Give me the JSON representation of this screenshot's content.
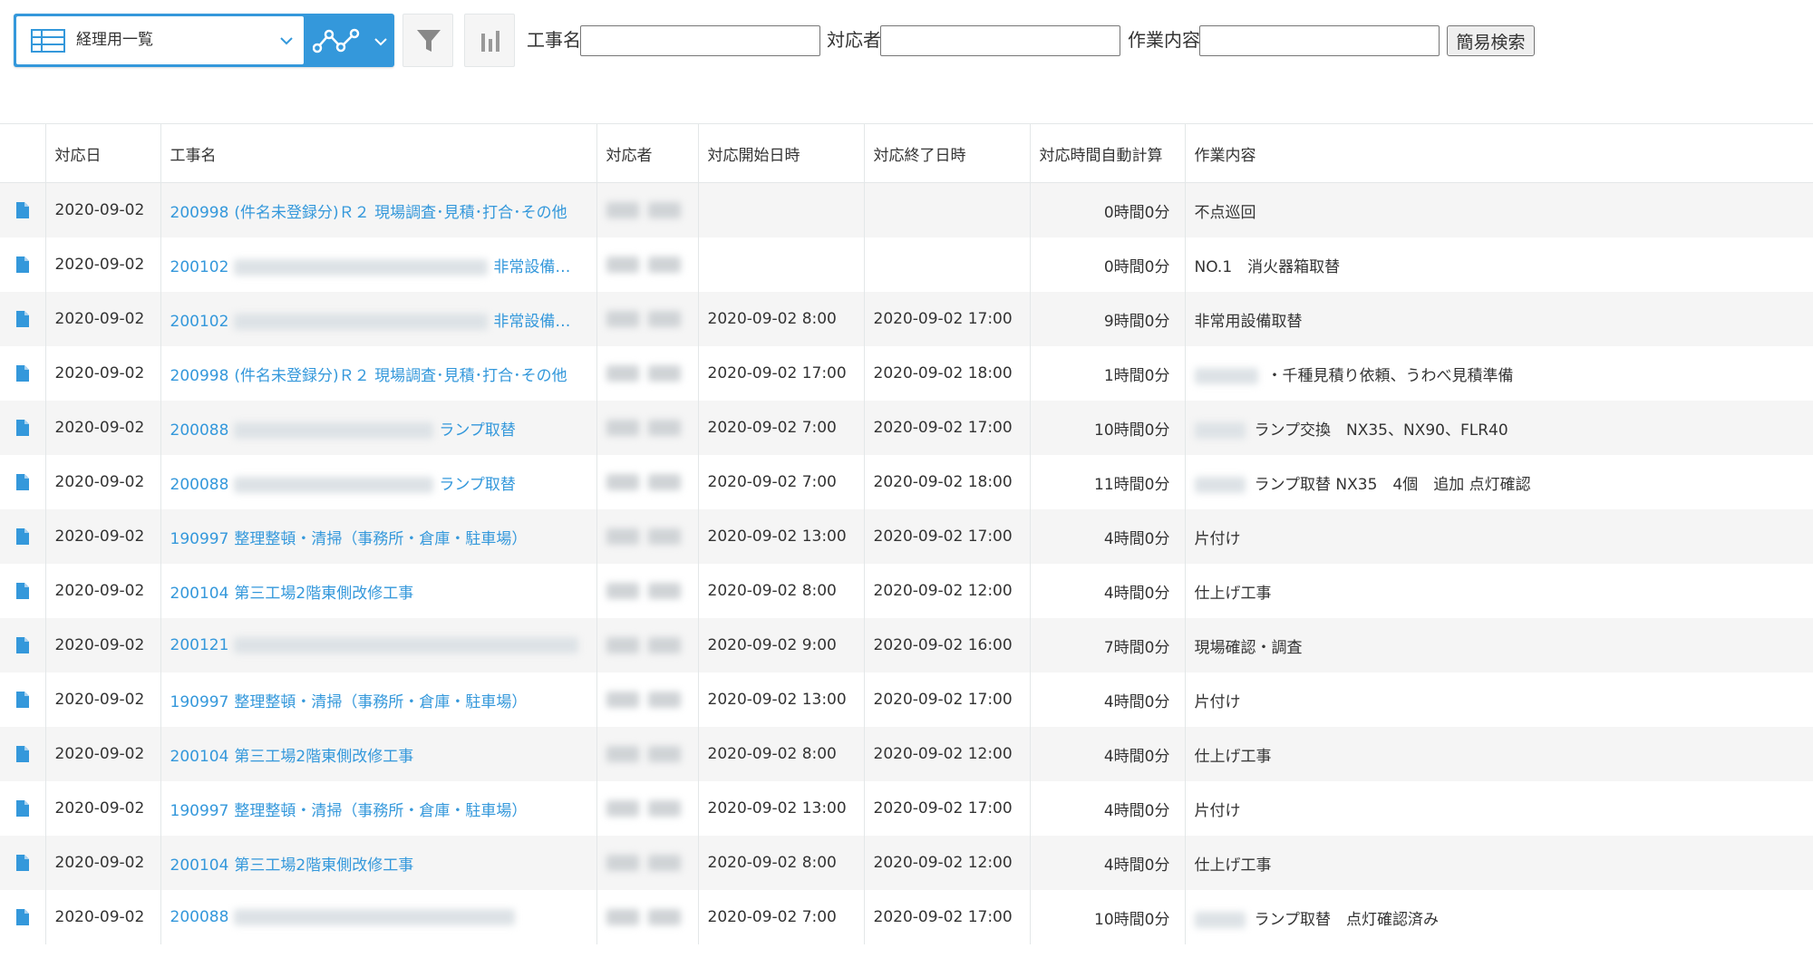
{
  "toolbar": {
    "view_name": "経理用一覧",
    "filters": [
      {
        "label": "工事名",
        "value": ""
      },
      {
        "label": "対応者",
        "value": ""
      },
      {
        "label": "作業内容",
        "value": ""
      }
    ],
    "search_button": "簡易検索"
  },
  "colors": {
    "accent": "#3498db",
    "link": "#3498db",
    "row_alt": "#f5f5f5",
    "border": "#e3e7e8"
  },
  "table": {
    "columns": [
      "対応日",
      "工事名",
      "対応者",
      "対応開始日時",
      "対応終了日時",
      "対応時間自動計算",
      "作業内容"
    ],
    "rows": [
      {
        "date": "2020-09-02",
        "project_code": "200998",
        "project_text": "(件名未登録分)Ｒ２ 現場調査･見積･打合･その他",
        "start": "",
        "end": "",
        "duration": "0時間0分",
        "work": "不点巡回"
      },
      {
        "date": "2020-09-02",
        "project_code": "200102",
        "project_text": "非常設備…",
        "start": "",
        "end": "",
        "duration": "0時間0分",
        "work": "NO.1　消火器箱取替"
      },
      {
        "date": "2020-09-02",
        "project_code": "200102",
        "project_text": "非常設備…",
        "start": "2020-09-02 8:00",
        "end": "2020-09-02 17:00",
        "duration": "9時間0分",
        "work": "非常用設備取替"
      },
      {
        "date": "2020-09-02",
        "project_code": "200998",
        "project_text": "(件名未登録分)Ｒ２ 現場調査･見積･打合･その他",
        "start": "2020-09-02 17:00",
        "end": "2020-09-02 18:00",
        "duration": "1時間0分",
        "work": "・千種見積り依頼、うわべ見積準備"
      },
      {
        "date": "2020-09-02",
        "project_code": "200088",
        "project_text": "ランプ取替",
        "start": "2020-09-02 7:00",
        "end": "2020-09-02 17:00",
        "duration": "10時間0分",
        "work": "ランプ交換　NX35、NX90、FLR40"
      },
      {
        "date": "2020-09-02",
        "project_code": "200088",
        "project_text": "ランプ取替",
        "start": "2020-09-02 7:00",
        "end": "2020-09-02 18:00",
        "duration": "11時間0分",
        "work": "ランプ取替 NX35　4個　追加 点灯確認"
      },
      {
        "date": "2020-09-02",
        "project_code": "190997",
        "project_text": "整理整頓・清掃（事務所・倉庫・駐車場）",
        "start": "2020-09-02 13:00",
        "end": "2020-09-02 17:00",
        "duration": "4時間0分",
        "work": "片付け"
      },
      {
        "date": "2020-09-02",
        "project_code": "200104",
        "project_text": "第三工場2階東側改修工事",
        "start": "2020-09-02 8:00",
        "end": "2020-09-02 12:00",
        "duration": "4時間0分",
        "work": "仕上げ工事"
      },
      {
        "date": "2020-09-02",
        "project_code": "200121",
        "project_text": "",
        "start": "2020-09-02 9:00",
        "end": "2020-09-02 16:00",
        "duration": "7時間0分",
        "work": "現場確認・調査"
      },
      {
        "date": "2020-09-02",
        "project_code": "190997",
        "project_text": "整理整頓・清掃（事務所・倉庫・駐車場）",
        "start": "2020-09-02 13:00",
        "end": "2020-09-02 17:00",
        "duration": "4時間0分",
        "work": "片付け"
      },
      {
        "date": "2020-09-02",
        "project_code": "200104",
        "project_text": "第三工場2階東側改修工事",
        "start": "2020-09-02 8:00",
        "end": "2020-09-02 12:00",
        "duration": "4時間0分",
        "work": "仕上げ工事"
      },
      {
        "date": "2020-09-02",
        "project_code": "190997",
        "project_text": "整理整頓・清掃（事務所・倉庫・駐車場）",
        "start": "2020-09-02 13:00",
        "end": "2020-09-02 17:00",
        "duration": "4時間0分",
        "work": "片付け"
      },
      {
        "date": "2020-09-02",
        "project_code": "200104",
        "project_text": "第三工場2階東側改修工事",
        "start": "2020-09-02 8:00",
        "end": "2020-09-02 12:00",
        "duration": "4時間0分",
        "work": "仕上げ工事"
      },
      {
        "date": "2020-09-02",
        "project_code": "200088",
        "project_text": "",
        "start": "2020-09-02 7:00",
        "end": "2020-09-02 17:00",
        "duration": "10時間0分",
        "work": "ランプ取替　点灯確認済み"
      }
    ]
  }
}
